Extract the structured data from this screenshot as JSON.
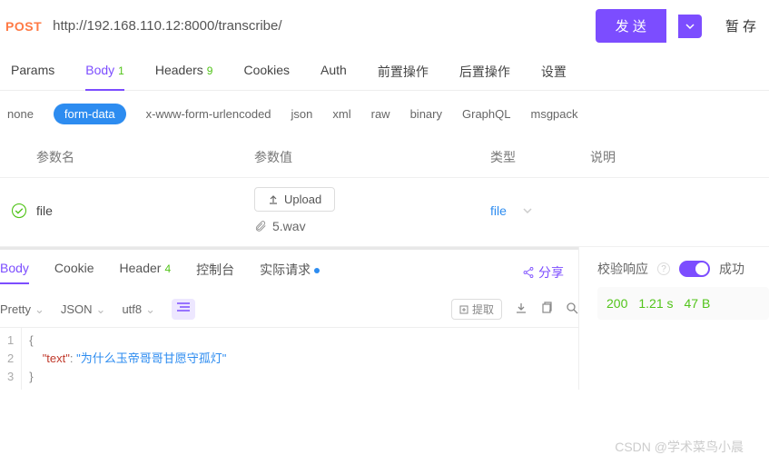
{
  "request": {
    "method": "POST",
    "url": "http://192.168.110.12:8000/transcribe/",
    "send_label": "发 送",
    "save_label": "暂 存"
  },
  "tabs": {
    "params": "Params",
    "body": "Body",
    "body_badge": "1",
    "headers": "Headers",
    "headers_badge": "9",
    "cookies": "Cookies",
    "auth": "Auth",
    "pre": "前置操作",
    "post": "后置操作",
    "settings": "设置"
  },
  "body_types": {
    "none": "none",
    "form_data": "form-data",
    "urlencoded": "x-www-form-urlencoded",
    "json": "json",
    "xml": "xml",
    "raw": "raw",
    "binary": "binary",
    "graphql": "GraphQL",
    "msgpack": "msgpack"
  },
  "columns": {
    "name": "参数名",
    "value": "参数值",
    "type": "类型",
    "desc": "说明"
  },
  "param_row": {
    "name": "file",
    "upload_label": "Upload",
    "filename": "5.wav",
    "type": "file"
  },
  "resp_tabs": {
    "body": "Body",
    "cookie": "Cookie",
    "header": "Header",
    "header_badge": "4",
    "console": "控制台",
    "actual": "实际请求",
    "share": "分享"
  },
  "validate": {
    "label": "校验响应",
    "success": "成功"
  },
  "status": {
    "code": "200",
    "time": "1.21 s",
    "size": "47 B"
  },
  "format": {
    "pretty": "Pretty",
    "json": "JSON",
    "utf8": "utf8",
    "extract": "提取"
  },
  "response_body": {
    "key": "\"text\"",
    "value": "\"为什么玉帝哥哥甘愿守孤灯\""
  },
  "watermark": "CSDN @学术菜鸟小晨"
}
